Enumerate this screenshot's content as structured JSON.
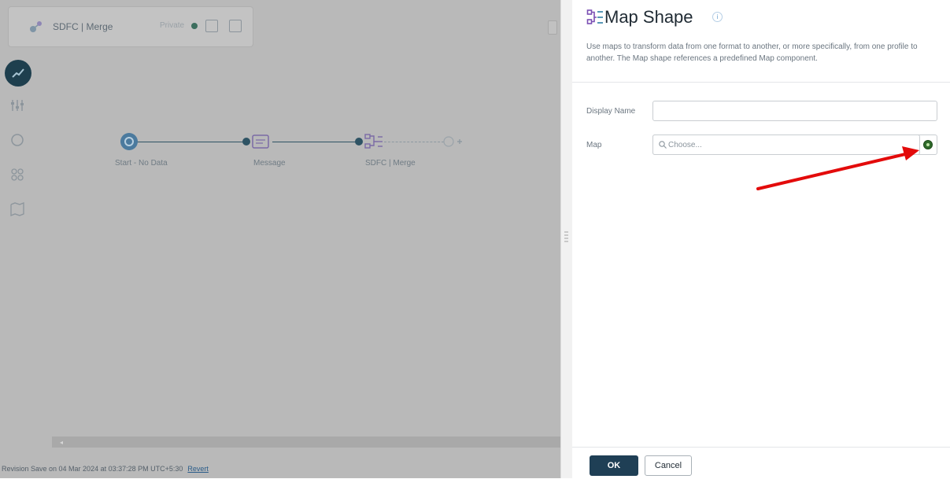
{
  "canvas": {
    "tab": {
      "title": "SDFC | Merge",
      "status": "Private"
    },
    "nodes": [
      {
        "label": "Start - No Data"
      },
      {
        "label": "Message"
      },
      {
        "label": "SDFC | Merge"
      }
    ],
    "footer": {
      "text": "Revision Save on 04 Mar 2024 at 03:37:28 PM UTC+5:30",
      "link": "Revert"
    }
  },
  "panel": {
    "title": "Map Shape",
    "description": "Use maps to transform data from one format to another, or more specifically, from one profile to another. The Map shape references a predefined Map component.",
    "display_name_label": "Display Name",
    "display_name_value": "",
    "map_label": "Map",
    "map_placeholder": "Choose...",
    "ok_label": "OK",
    "cancel_label": "Cancel"
  },
  "colors": {
    "annotation_arrow": "#e30b0b",
    "primary_button": "#1f3f55",
    "add_button": "#2f6a2a"
  }
}
